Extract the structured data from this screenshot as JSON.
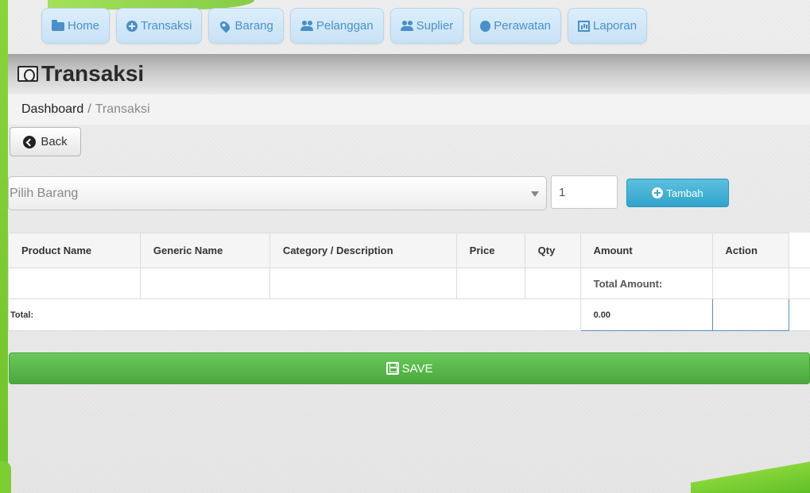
{
  "nav": {
    "home": "Home",
    "transaksi": "Transaksi",
    "barang": "Barang",
    "pelanggan": "Pelanggan",
    "suplier": "Suplier",
    "perawatan": "Perawatan",
    "laporan": "Laporan"
  },
  "page": {
    "title": "Transaksi"
  },
  "breadcrumb": {
    "home": "Dashboard",
    "separator": "/",
    "current": "Transaksi"
  },
  "back_button": {
    "label": "Back"
  },
  "form": {
    "product_select": {
      "selected": "Pilih Barang"
    },
    "qty_input": {
      "value": "1"
    },
    "add_button": {
      "label": "Tambah"
    }
  },
  "table": {
    "headers": [
      "Product Name",
      "Generic Name",
      "Category / Description",
      "Price",
      "Qty",
      "Amount",
      "Action"
    ],
    "total_amount_label": "Total Amount:",
    "total_label": "Total:",
    "total_value": "0.00"
  },
  "save_button": {
    "label": "SAVE"
  },
  "colors": {
    "nav_bg": "#c8e2f5",
    "nav_text": "#4a8fc8",
    "add_button": "#31a4cc",
    "save_button": "#4aa83d",
    "decor_green": "#7ccf33"
  }
}
